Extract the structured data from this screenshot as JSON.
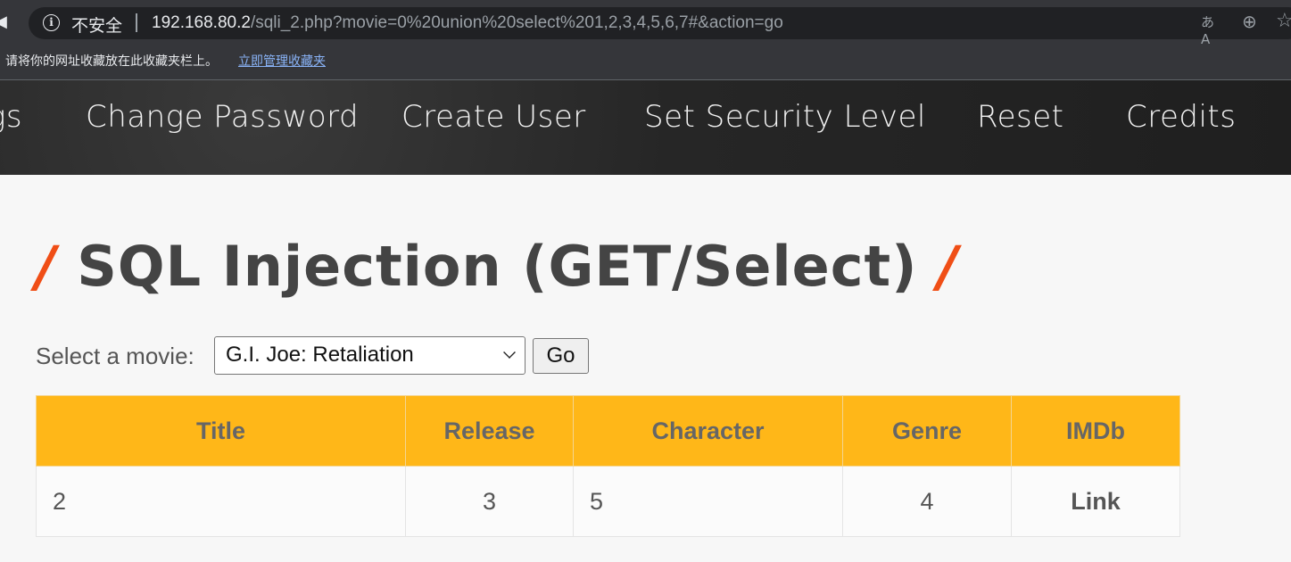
{
  "browser": {
    "not_secure_label": "不安全",
    "url_host": "192.168.80.2",
    "url_path": "/sqli_2.php?movie=0%20union%20select%201,2,3,4,5,6,7#&action=go",
    "bookmark_hint": "请将你的网址收藏放在此收藏夹栏上。",
    "bookmark_manage_link": "立即管理收藏夹",
    "icons": [
      "back-icon",
      "info-icon",
      "translate-icon",
      "zoom-icon",
      "star-icon"
    ]
  },
  "nav": {
    "items": [
      "gs",
      "Change Password",
      "Create User",
      "Set Security Level",
      "Reset",
      "Credits"
    ]
  },
  "page": {
    "slash_left": "/",
    "title": "SQL Injection (GET/Select)",
    "slash_right": "/",
    "select_label": "Select a movie:",
    "selected_movie": "G.I. Joe: Retaliation",
    "go_label": "Go"
  },
  "table": {
    "headers": [
      "Title",
      "Release",
      "Character",
      "Genre",
      "IMDb"
    ],
    "rows": [
      [
        "2",
        "3",
        "5",
        "4",
        "Link"
      ]
    ]
  },
  "colors": {
    "header_bg": "#ffb718",
    "accent_slash": "#f04e16",
    "nav_bg": "#262626"
  }
}
